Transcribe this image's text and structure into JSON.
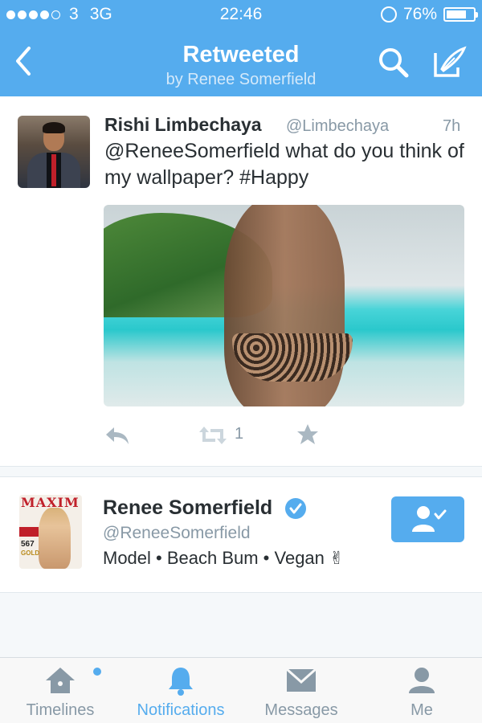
{
  "status_bar": {
    "signal_bars_filled": 4,
    "signal_bars_total": 5,
    "carrier": "3",
    "network": "3G",
    "time": "22:46",
    "battery_percent_label": "76%",
    "battery_level": 0.76
  },
  "nav": {
    "title": "Retweeted",
    "subtitle": "by Renee Somerfield",
    "icons": [
      "back-chevron-icon",
      "search-icon",
      "compose-icon"
    ]
  },
  "tweet": {
    "author_name": "Rishi Limbechaya",
    "author_handle": "@Limbechaya",
    "time": "7h",
    "text": "@ReneeSomerfield what do you think of my wallpaper? #Happy",
    "retweet_count": "1",
    "actions": [
      "reply-icon",
      "retweet-icon",
      "favorite-star-icon"
    ]
  },
  "profile_card": {
    "name": "Renee Somerfield",
    "verified": true,
    "handle": "@ReneeSomerfield",
    "bio": "Model • Beach Bum • Vegan ✌",
    "follow_state": "following",
    "avatar_magazine_text": "MAXIM",
    "avatar_cover_number": "567",
    "avatar_cover_gold": "GOLD",
    "avatar_cover_name": "RENEE"
  },
  "tab_bar": {
    "tabs": [
      {
        "label": "Timelines",
        "icon": "home-icon",
        "active": false
      },
      {
        "label": "Notifications",
        "icon": "bell-icon",
        "active": true
      },
      {
        "label": "Messages",
        "icon": "envelope-icon",
        "active": false
      },
      {
        "label": "Me",
        "icon": "person-icon",
        "active": false
      }
    ]
  },
  "colors": {
    "brand_blue": "#55acee",
    "text_dark": "#292f33",
    "text_muted": "#8899a6",
    "background": "#f5f8fa"
  }
}
